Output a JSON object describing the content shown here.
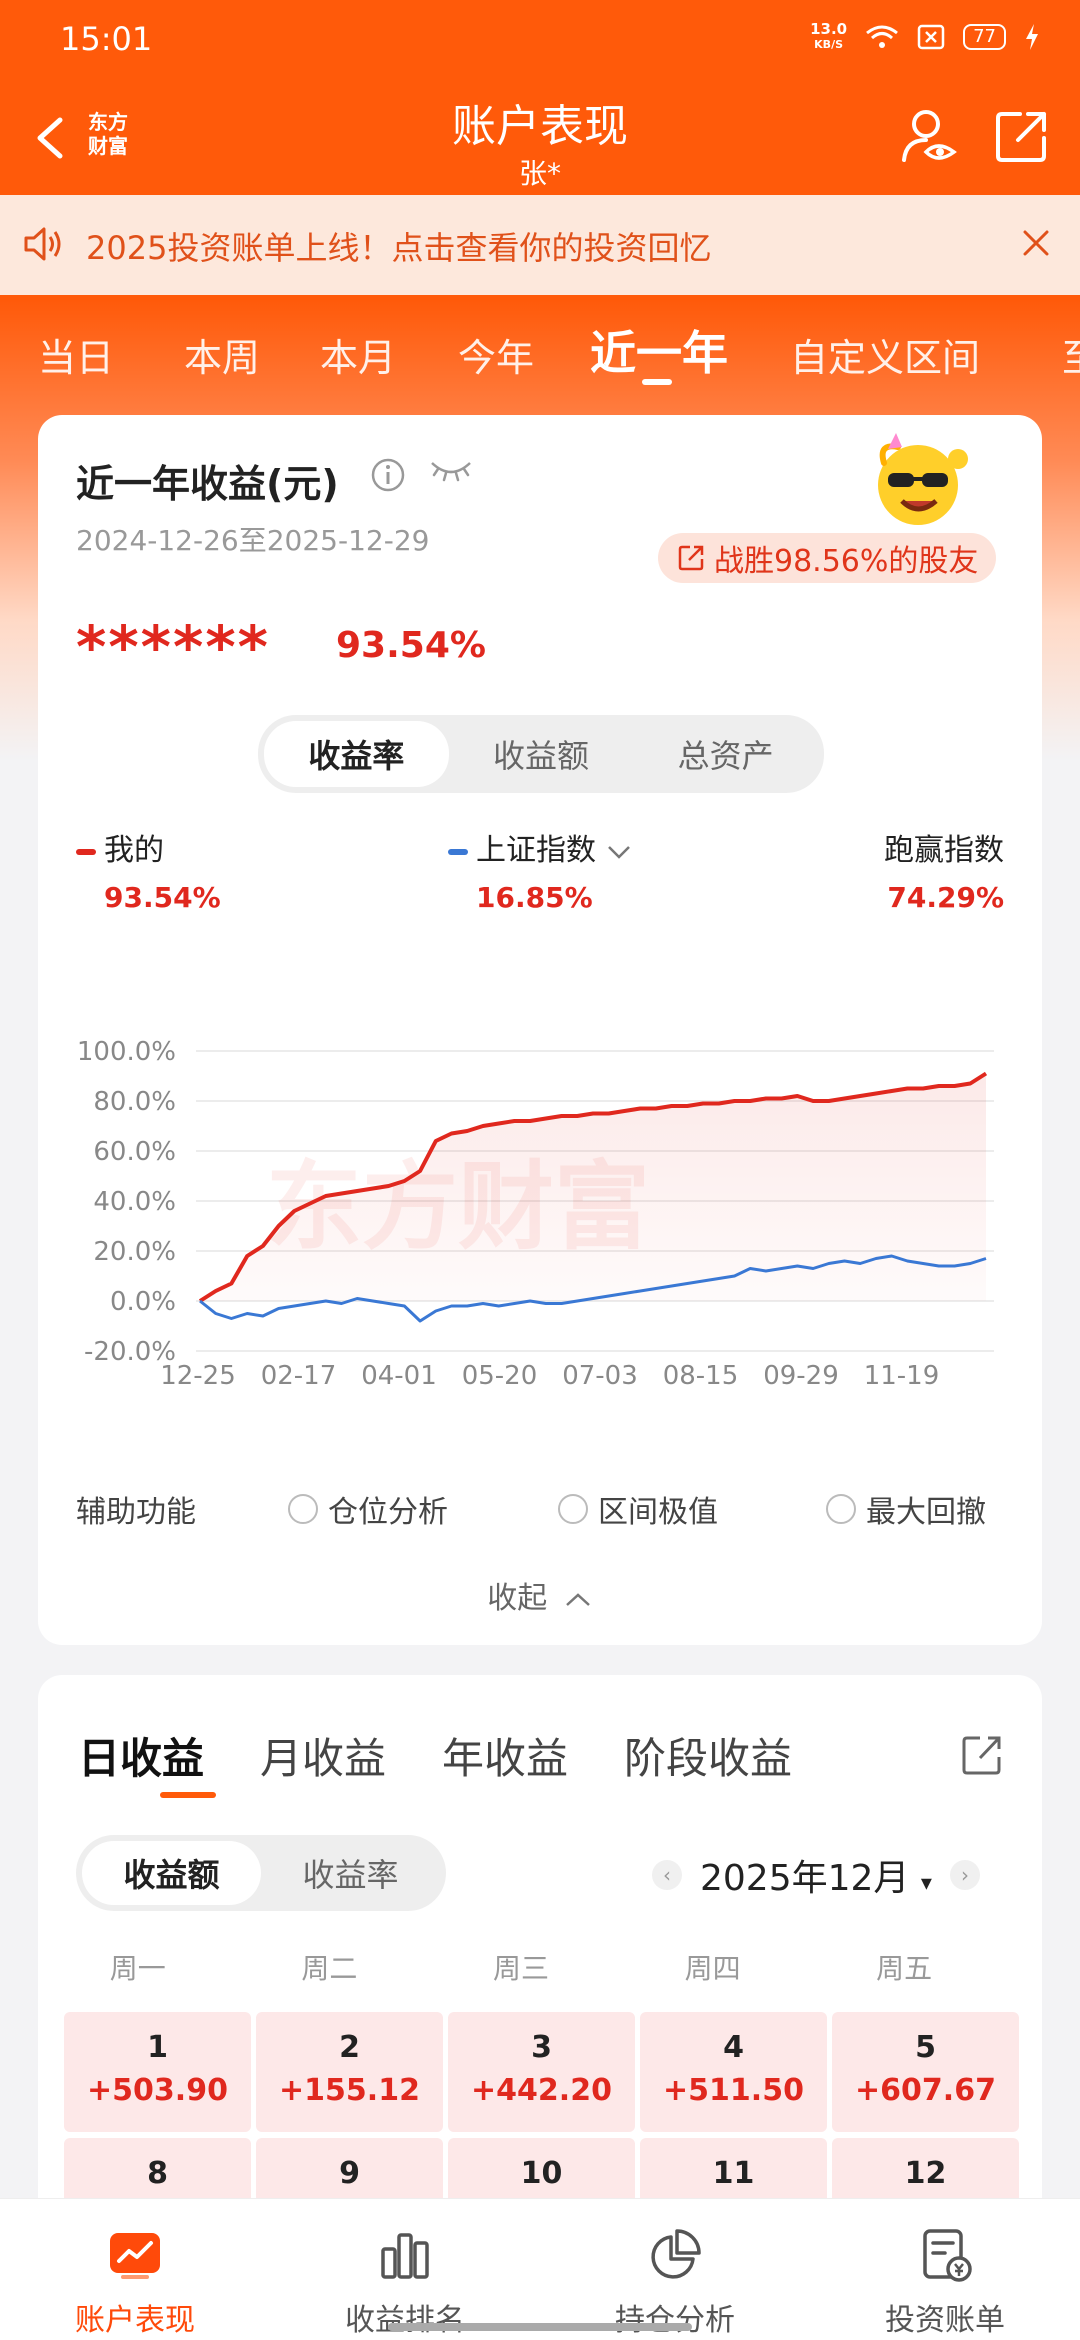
{
  "status_bar": {
    "time": "15:01",
    "net_speed": "13.0",
    "net_unit": "KB/S",
    "battery": "77"
  },
  "header": {
    "back_label": "东方\n财富",
    "title": "账户表现",
    "subtitle": "张*"
  },
  "notice": {
    "text": "2025投资账单上线！点击查看你的投资回忆"
  },
  "period_tabs": [
    "当日",
    "本周",
    "本月",
    "今年",
    "近一年",
    "自定义区间",
    "至"
  ],
  "active_period": "近一年",
  "performance": {
    "title": "近一年收益(元)",
    "date_range": "2024-12-26至2025-12-29",
    "beat_text": "战胜98.56%的股友",
    "masked_value": "******",
    "return_pct": "93.54%",
    "segments": [
      "收益率",
      "收益额",
      "总资产"
    ],
    "active_segment": "收益率",
    "legend": {
      "mine_label": "我的",
      "mine_value": "93.54%",
      "index_label": "上证指数",
      "index_value": "16.85%",
      "beat_label": "跑赢指数",
      "beat_value": "74.29%"
    },
    "aux": {
      "label": "辅助功能",
      "options": [
        "仓位分析",
        "区间极值",
        "最大回撤"
      ]
    },
    "collapse_label": "收起"
  },
  "chart_data": {
    "type": "line",
    "yticks": [
      "100.0%",
      "80.0%",
      "60.0%",
      "40.0%",
      "20.0%",
      "0.0%",
      "-20.0%"
    ],
    "ylim": [
      -20,
      100
    ],
    "xticks": [
      "12-25",
      "02-17",
      "04-01",
      "05-20",
      "07-03",
      "08-15",
      "09-29",
      "11-19"
    ],
    "watermark": "东方财富",
    "colors": {
      "mine": "#e0281e",
      "index": "#3a78d4"
    },
    "series": [
      {
        "name": "我的",
        "values": [
          0,
          4,
          7,
          18,
          22,
          30,
          36,
          39,
          42,
          43,
          44,
          45,
          46,
          48,
          52,
          64,
          67,
          68,
          70,
          71,
          72,
          72,
          73,
          74,
          74,
          75,
          75,
          76,
          77,
          77,
          78,
          78,
          79,
          79,
          80,
          80,
          81,
          81,
          82,
          80,
          80,
          81,
          82,
          83,
          84,
          85,
          85,
          86,
          86,
          87,
          91
        ]
      },
      {
        "name": "上证指数",
        "values": [
          0,
          -5,
          -7,
          -5,
          -6,
          -3,
          -2,
          -1,
          0,
          -1,
          1,
          0,
          -1,
          -2,
          -8,
          -4,
          -2,
          -2,
          -1,
          -2,
          -1,
          0,
          -1,
          -1,
          0,
          1,
          2,
          3,
          4,
          5,
          6,
          7,
          8,
          9,
          10,
          13,
          12,
          13,
          14,
          13,
          15,
          16,
          15,
          17,
          18,
          16,
          15,
          14,
          14,
          15,
          17
        ]
      }
    ]
  },
  "daily": {
    "tabs": [
      "日收益",
      "月收益",
      "年收益",
      "阶段收益"
    ],
    "active_tab": "日收益",
    "segments": [
      "收益额",
      "收益率"
    ],
    "active_segment": "收益额",
    "month": "2025年12月",
    "weekdays": [
      "周一",
      "周二",
      "周三",
      "周四",
      "周五"
    ],
    "days": [
      {
        "day": "1",
        "amount": "+503.90"
      },
      {
        "day": "2",
        "amount": "+155.12"
      },
      {
        "day": "3",
        "amount": "+442.20"
      },
      {
        "day": "4",
        "amount": "+511.50"
      },
      {
        "day": "5",
        "amount": "+607.67"
      },
      {
        "day": "8",
        "amount": ""
      },
      {
        "day": "9",
        "amount": ""
      },
      {
        "day": "10",
        "amount": ""
      },
      {
        "day": "11",
        "amount": ""
      },
      {
        "day": "12",
        "amount": ""
      }
    ]
  },
  "bottom_nav": [
    "账户表现",
    "收益排名",
    "持仓分析",
    "投资账单"
  ],
  "active_bottom": "账户表现"
}
